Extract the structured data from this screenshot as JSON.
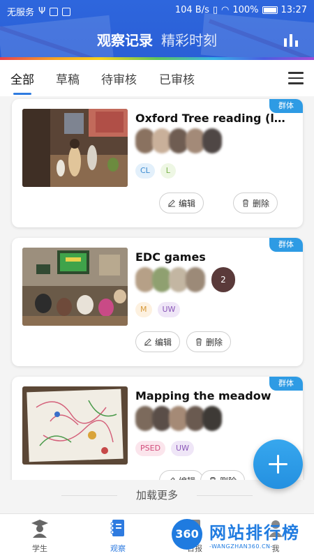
{
  "status_bar": {
    "carrier": "无服务",
    "speed": "104 B/s",
    "battery": "100%",
    "time": "13:27"
  },
  "header": {
    "title": "观察记录",
    "subtitle": "精彩时刻",
    "stats_icon": "bar-chart-icon",
    "background_color": "#2e66dd"
  },
  "tabs": [
    {
      "label": "全部",
      "active": true
    },
    {
      "label": "草稿",
      "active": false
    },
    {
      "label": "待审核",
      "active": false
    },
    {
      "label": "已审核",
      "active": false
    }
  ],
  "cards": [
    {
      "badge": "群体",
      "title": "Oxford Tree reading (level…",
      "tags": [
        "CL",
        "L"
      ],
      "edit_label": "编辑",
      "delete_label": "删除"
    },
    {
      "badge": "群体",
      "title": "EDC games",
      "avatar_more": "2",
      "tags": [
        "M",
        "UW"
      ],
      "edit_label": "编辑",
      "delete_label": "删除"
    },
    {
      "badge": "群体",
      "title": "Mapping the meadow",
      "tags": [
        "PSED",
        "UW"
      ],
      "edit_label": "编辑",
      "delete_label": "删除"
    }
  ],
  "load_more": "加载更多",
  "fab_icon": "plus-icon",
  "bottom_nav": [
    {
      "label": "学生",
      "icon": "student-icon",
      "active": false
    },
    {
      "label": "观察",
      "icon": "notebook-icon",
      "active": true
    },
    {
      "label": "日报",
      "icon": "report-icon",
      "active": false
    },
    {
      "label": "我",
      "icon": "user-icon",
      "active": false
    }
  ],
  "watermark": {
    "badge": "360",
    "text": "网站排行榜",
    "sub": "-WANGZHAN360.CN-"
  }
}
